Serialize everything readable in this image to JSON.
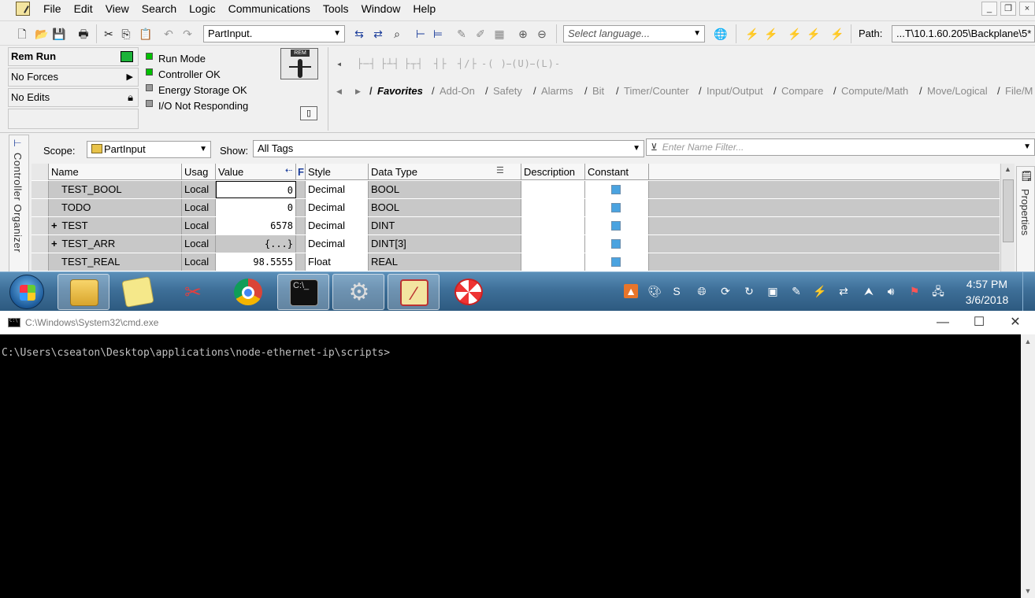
{
  "menu": [
    "File",
    "Edit",
    "View",
    "Search",
    "Logic",
    "Communications",
    "Tools",
    "Window",
    "Help"
  ],
  "toolbar": {
    "routine_combo": "PartInput.",
    "language_placeholder": "Select language...",
    "path_label": "Path:",
    "path_value": "...T\\10.1.60.205\\Backplane\\5*"
  },
  "status": {
    "mode": "Rem Run",
    "forces": "No Forces",
    "edits": "No Edits",
    "indicators": [
      {
        "label": "Run Mode",
        "color": "#00c000"
      },
      {
        "label": "Controller OK",
        "color": "#00c000"
      },
      {
        "label": "Energy Storage OK",
        "color": "#9a9a9a"
      },
      {
        "label": "I/O Not Responding",
        "color": "#9a9a9a"
      }
    ],
    "key_label": "REM"
  },
  "instruction_tabs": [
    "Favorites",
    "Add-On",
    "Safety",
    "Alarms",
    "Bit",
    "Timer/Counter",
    "Input/Output",
    "Compare",
    "Compute/Math",
    "Move/Logical",
    "File/M"
  ],
  "tags": {
    "organizer_label": "Controller Organizer",
    "properties_label": "Properties",
    "scope_label": "Scope:",
    "scope_value": "PartInput",
    "show_label": "Show:",
    "show_value": "All Tags",
    "filter_placeholder": "Enter Name Filter...",
    "columns": [
      "Name",
      "Usag",
      "Value",
      "F",
      "Style",
      "Data Type",
      "Description",
      "Constant"
    ],
    "rows": [
      {
        "expand": "",
        "name": "TEST_BOOL",
        "usage": "Local",
        "value": "0",
        "style": "Decimal",
        "type": "BOOL"
      },
      {
        "expand": "",
        "name": "TODO",
        "usage": "Local",
        "value": "0",
        "style": "Decimal",
        "type": "BOOL"
      },
      {
        "expand": "+",
        "name": "TEST",
        "usage": "Local",
        "value": "6578",
        "style": "Decimal",
        "type": "DINT"
      },
      {
        "expand": "+",
        "name": "TEST_ARR",
        "usage": "Local",
        "value": "{...}",
        "style": "Decimal",
        "type": "DINT[3]"
      },
      {
        "expand": "",
        "name": "TEST_REAL",
        "usage": "Local",
        "value": "98.5555",
        "style": "Float",
        "type": "REAL"
      }
    ]
  },
  "taskbar": {
    "time": "4:57 PM",
    "date": "3/6/2018"
  },
  "cmd": {
    "title": "C:\\Windows\\System32\\cmd.exe",
    "prompt": "C:\\Users\\cseaton\\Desktop\\applications\\node-ethernet-ip\\scripts>"
  }
}
